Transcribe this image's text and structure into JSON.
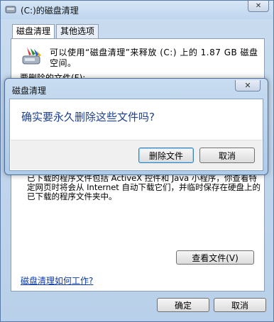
{
  "window": {
    "title": "(C:)的磁盘清理",
    "close_glyph": "✕"
  },
  "tabs": [
    {
      "label": "磁盘清理"
    },
    {
      "label": "其他选项"
    }
  ],
  "panel": {
    "intro": "可以使用“磁盘清理”来释放 (C:) 上的 1.87 GB 磁盘空间。",
    "files_label": "要删除的文件(F):",
    "description": "已下载的程序文件包括 ActiveX 控件和 Java 小程序，你查看特定网页时将会从 Internet 自动下载它们，并临时保存在硬盘上的已下载的程序文件夹中。",
    "view_files_button": "查看文件(V)",
    "how_link": "磁盘清理如何工作?"
  },
  "footer": {
    "ok_label": "确定",
    "cancel_label": "取消"
  },
  "dialog": {
    "title": "磁盘清理",
    "close_glyph": "✕",
    "question": "确实要永久删除这些文件吗?",
    "delete_button": "删除文件",
    "cancel_button": "取消"
  }
}
